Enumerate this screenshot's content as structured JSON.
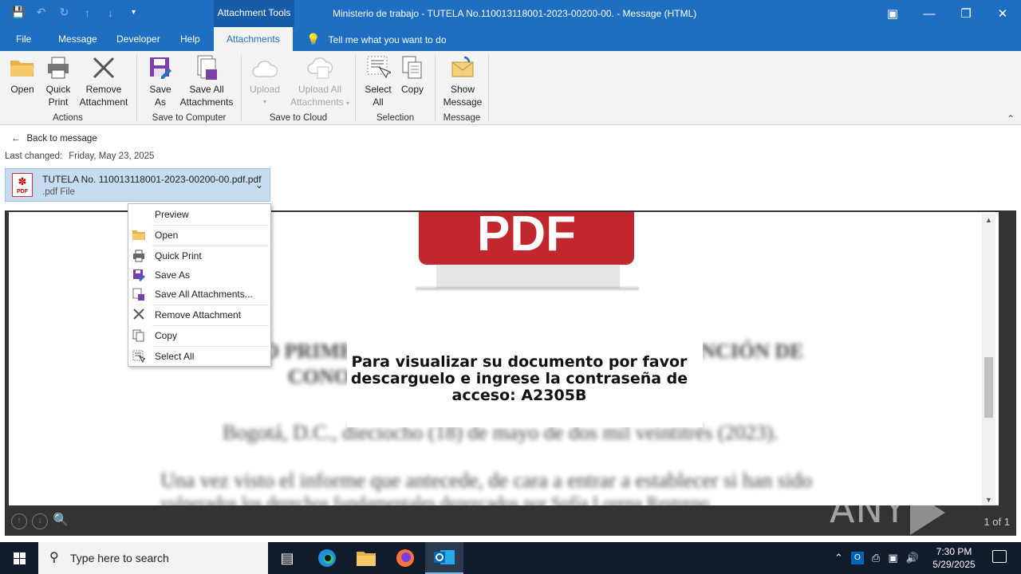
{
  "window": {
    "title": "Ministerio de trabajo - TUTELA No.110013118001-2023-00200-00.  -  Message (HTML)",
    "context_tab": "Attachment Tools"
  },
  "qat": {
    "icons": [
      "save-icon",
      "undo-icon",
      "redo-icon",
      "up-icon",
      "down-icon",
      "customize-icon"
    ]
  },
  "tabs": [
    {
      "label": "File"
    },
    {
      "label": "Message"
    },
    {
      "label": "Developer"
    },
    {
      "label": "Help"
    },
    {
      "label": "Attachments"
    }
  ],
  "tellme": "Tell me what you want to do",
  "ribbon": {
    "groups": [
      {
        "label": "Actions"
      },
      {
        "label": "Save to Computer"
      },
      {
        "label": "Save to Cloud"
      },
      {
        "label": "Selection"
      },
      {
        "label": "Message"
      }
    ],
    "buttons": {
      "open": "Open",
      "quick_print_1": "Quick",
      "quick_print_2": "Print",
      "remove_1": "Remove",
      "remove_2": "Attachment",
      "save_as_1": "Save",
      "save_as_2": "As",
      "save_all_1": "Save All",
      "save_all_2": "Attachments",
      "upload": "Upload",
      "upload_all_1": "Upload All",
      "upload_all_2": "Attachments",
      "select_all_1": "Select",
      "select_all_2": "All",
      "copy": "Copy",
      "show_msg_1": "Show",
      "show_msg_2": "Message"
    }
  },
  "attachment": {
    "back": "Back to message",
    "last_changed_label": "Last changed:",
    "last_changed_value": "Friday, May 23, 2025",
    "filename": "TUTELA No. 110013118001-2023-00200-00.pdf.pdf",
    "filetype": ".pdf File",
    "icon_label": "PDF"
  },
  "preview": {
    "pdf_logo": "PDF",
    "message": "Para visualizar su documento por favor descarguelo e ingrese la contraseña de acceso: A2305B",
    "page_count": "1 of 1",
    "watermark": "ANY RUN"
  },
  "context_menu": [
    {
      "label": "Preview",
      "icon": ""
    },
    {
      "label": "Open",
      "icon": "folder-icon"
    },
    {
      "label": "Quick Print",
      "icon": "printer-icon"
    },
    {
      "label": "Save As",
      "icon": "save-as-icon"
    },
    {
      "label": "Save All Attachments...",
      "icon": "save-all-icon"
    },
    {
      "label": "Remove Attachment",
      "icon": "remove-icon"
    },
    {
      "label": "Copy",
      "icon": "copy-icon"
    },
    {
      "label": "Select All",
      "icon": "select-all-icon"
    }
  ],
  "taskbar": {
    "search_placeholder": "Type here to search",
    "time": "7:30 PM",
    "date": "5/29/2025"
  }
}
